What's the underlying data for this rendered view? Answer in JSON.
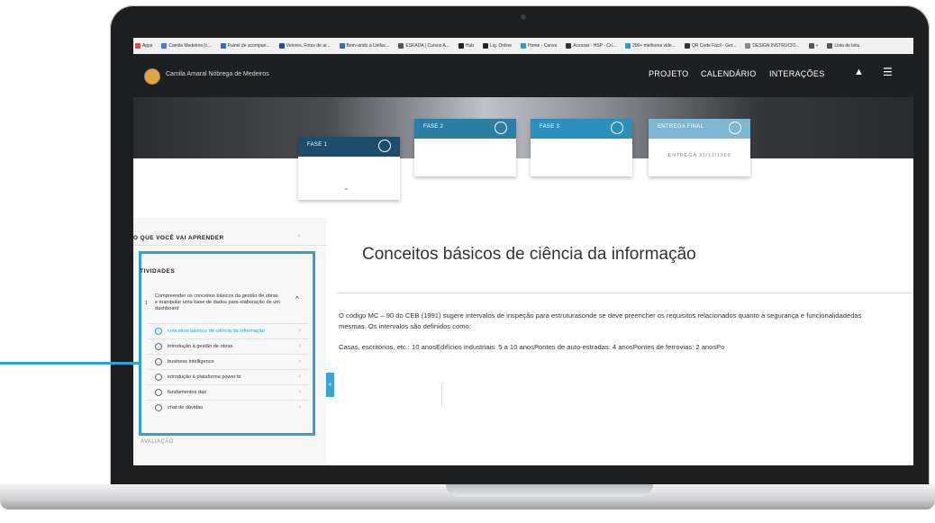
{
  "bookmarks": [
    {
      "label": "Apps",
      "icon": "apps-grid-icon",
      "color": "#e8453c"
    },
    {
      "label": "Camila Medeiros (c...",
      "icon": "profile-icon",
      "color": "#3b7ddd"
    },
    {
      "label": "Painel de acompan...",
      "icon": "dashboard-icon",
      "color": "#2c6ecb"
    },
    {
      "label": "Vetores, Fotos de ar...",
      "icon": "vector-icon",
      "color": "#1f4fa0"
    },
    {
      "label": "Bem-vindo à Unifac...",
      "icon": "school-icon",
      "color": "#2c6ecb"
    },
    {
      "label": "ESKADA | Cursos A...",
      "icon": "eskada-icon",
      "color": "#555555"
    },
    {
      "label": "Hub",
      "icon": "hub-icon",
      "color": "#222222"
    },
    {
      "label": "Lig. Online",
      "icon": "lig-icon",
      "color": "#222222"
    },
    {
      "label": "Home - Canva",
      "icon": "canva-icon",
      "color": "#1aa3c6"
    },
    {
      "label": "Acessar - HSP - Cri...",
      "icon": "hsp-icon",
      "color": "#333333"
    },
    {
      "label": "200+ melhores vide...",
      "icon": "video-icon",
      "color": "#18a3d8"
    },
    {
      "label": "QR Code Fácil - Ger...",
      "icon": "qr-icon",
      "color": "#333333"
    },
    {
      "label": "DESIGN INSTRUCIO...",
      "icon": "design-icon",
      "color": "#888888"
    },
    {
      "label": "»",
      "icon": "more-bookmarks-icon",
      "color": "#555555"
    },
    {
      "label": "Lista de leitu",
      "icon": "reading-list-icon",
      "color": "#555555"
    }
  ],
  "header": {
    "user_name": "Camila Amaral Nóbrega de Medeiros",
    "nav": [
      "PROJETO",
      "CALENDÁRIO",
      "INTERAÇÕES"
    ]
  },
  "phases": [
    {
      "label": "FASE 1",
      "color": "#1d4d6b"
    },
    {
      "label": "FASE 2",
      "color": "#2b7fa6"
    },
    {
      "label": "FASE 3",
      "color": "#2a8fbd"
    },
    {
      "label": "ENTREGA FINAL",
      "color": "#7fb6d4",
      "sub": "ENTREGA 31/12/1969"
    }
  ],
  "sidebar": {
    "learn_title": "O QUE VOCÊ VAI APRENDER",
    "activities_title": "TIVIDADES",
    "activity_number": "1",
    "activity_text": "Compreender os conceitos básicos da gestão de obras e manipular uma base de dados para elaboração de um dashboard",
    "items": [
      {
        "label": "conceitos básicos de ciência da informação",
        "active": true
      },
      {
        "label": "introdução à gestão de obras",
        "active": false
      },
      {
        "label": "business intelligence",
        "active": false
      },
      {
        "label": "introdução à plataforma power bi",
        "active": false
      },
      {
        "label": "fundamentos dax",
        "active": false
      },
      {
        "label": "chat de dúvidas",
        "active": false
      }
    ],
    "next_section": "AVALIAÇÃO",
    "collapse_label": "«"
  },
  "content": {
    "title": "Conceitos básicos de ciência da informação",
    "paragraph1": "O código MC – 90 do CEB (1991) sugere intervalos de inspeção para estruturasonde se deve preencher os requisitos relacionados quanto à segurança e funcionalidadedas mesmas. Os intervalos são definidos como:",
    "paragraph2": "Casas, escritórios, etc.: 10 anosEdifícios industriais: 5 a 10 anosPontes de auto-estradas: 4 anosPontes de ferrovias: 2 anosPo"
  },
  "colors": {
    "accent": "#2ea2d9",
    "active_item": "#2ea2d9",
    "header_bg": "#1e1f21"
  }
}
